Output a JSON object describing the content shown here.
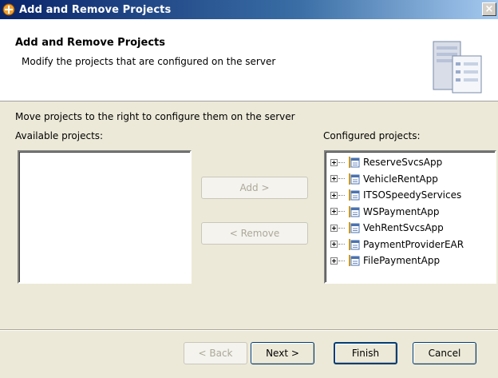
{
  "window": {
    "title": "Add and Remove Projects",
    "close_glyph": "×",
    "icon": "eclipse-app-icon"
  },
  "banner": {
    "title": "Add and Remove Projects",
    "description": "Modify the projects that are configured on the server",
    "graphic": "server-graphic"
  },
  "body": {
    "instruction": "Move projects to the right to configure them on the server",
    "available_label": "Available projects:",
    "configured_label": "Configured projects:",
    "available_projects": [],
    "configured_projects": [
      "ReserveSvcsApp",
      "VehicleRentApp",
      "ITSOSpeedyServices",
      "WSPaymentApp",
      "VehRentSvcsApp",
      "PaymentProviderEAR",
      "FilePaymentApp"
    ]
  },
  "buttons": {
    "add": "Add >",
    "remove": "< Remove",
    "back": "< Back",
    "next": "Next >",
    "finish": "Finish",
    "cancel": "Cancel"
  },
  "colors": {
    "titlebar_start": "#0a246a",
    "titlebar_end": "#a6caf0",
    "dialog_bg": "#ece9d8",
    "disabled_text": "#aca899"
  }
}
